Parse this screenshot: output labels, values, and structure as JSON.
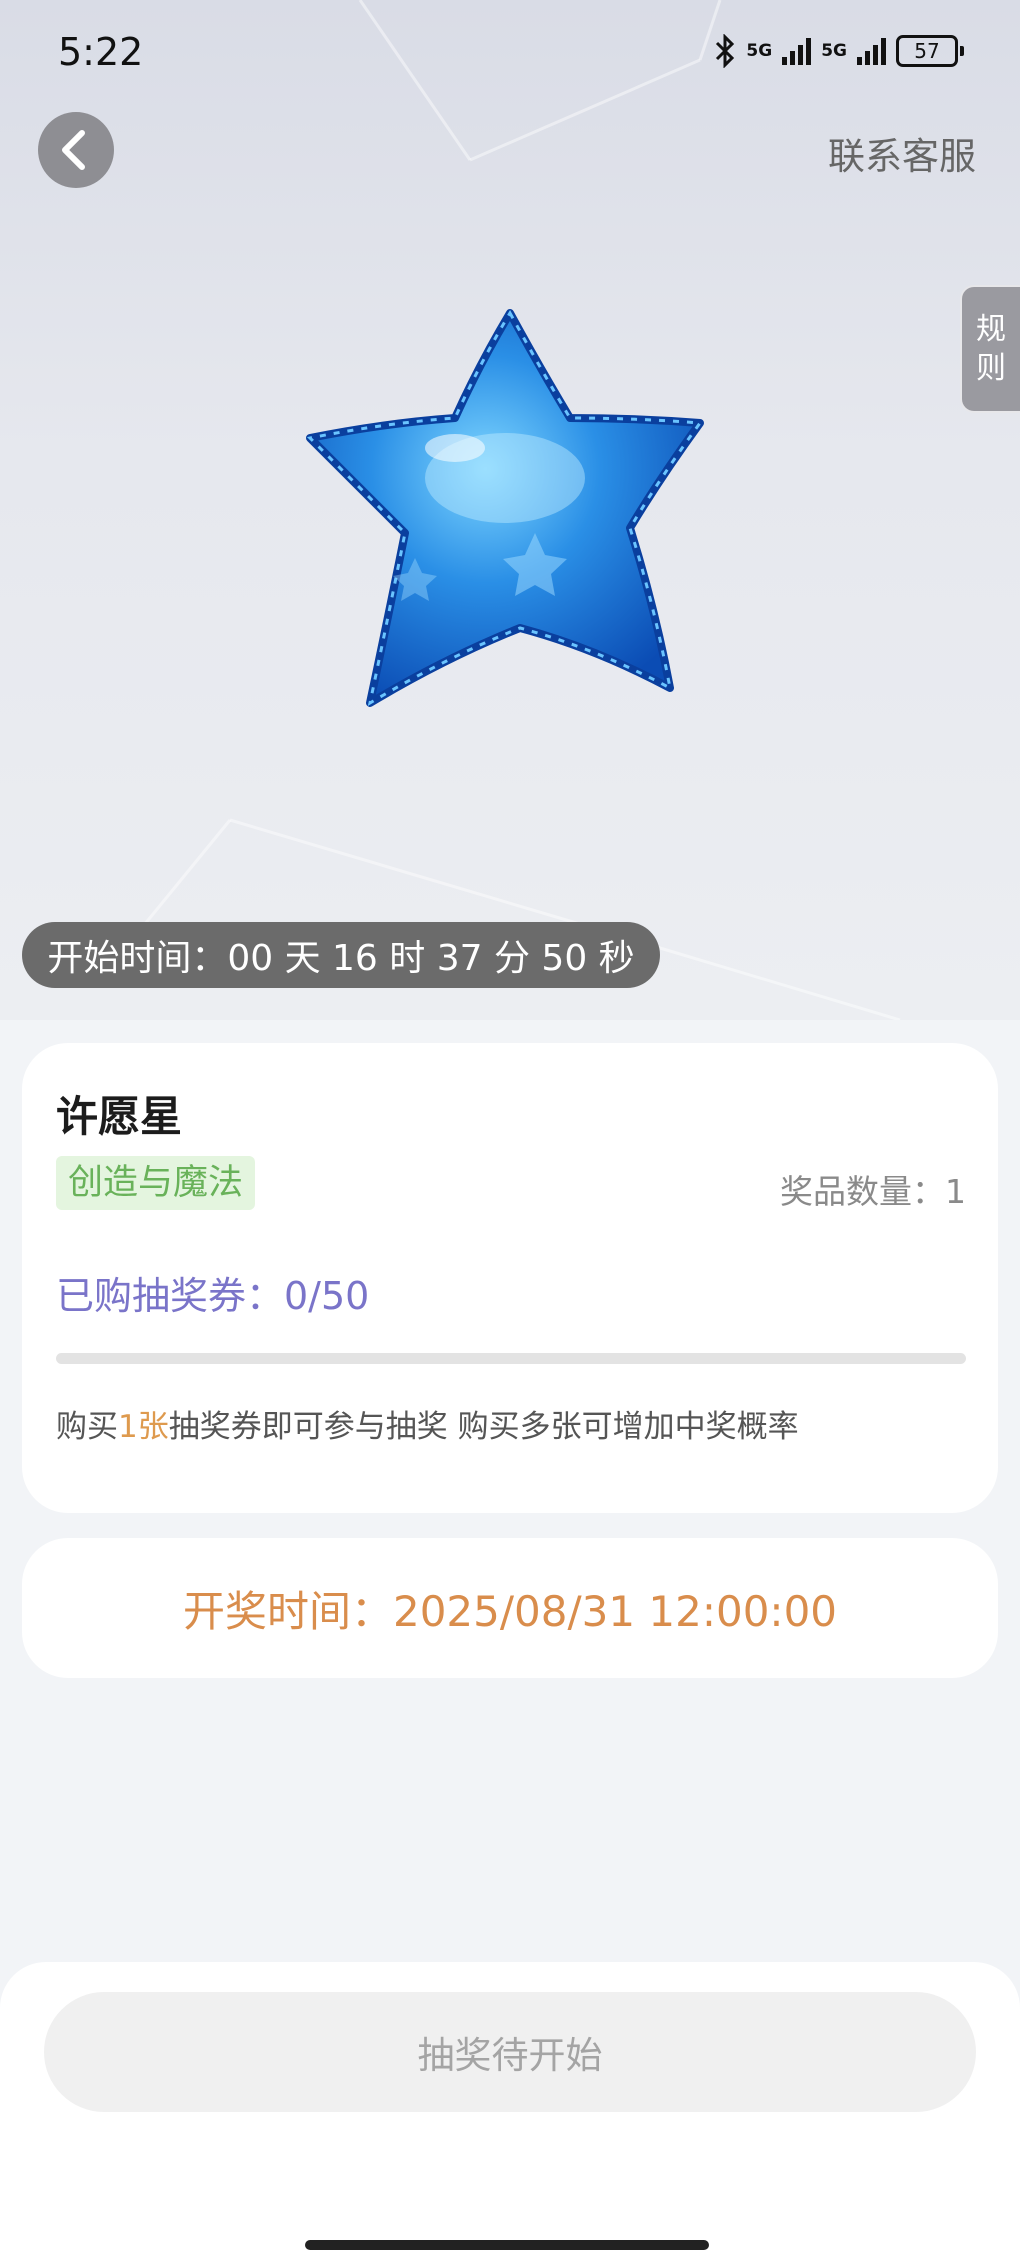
{
  "status_bar": {
    "time": "5:22",
    "network_1": "5G",
    "network_2": "5G",
    "battery": "57",
    "icons": [
      "bluetooth-icon",
      "signal-icon",
      "signal-icon",
      "battery-icon"
    ]
  },
  "header": {
    "back_icon": "chevron-left-icon",
    "customer_service": "联系客服",
    "rules_char_1": "规",
    "rules_char_2": "则"
  },
  "hero": {
    "image": "blue-star-balloon",
    "countdown": "开始时间：00 天 16 时 37 分 50 秒"
  },
  "prize": {
    "name": "许愿星",
    "tag": "创造与魔法",
    "quantity": "奖品数量：1",
    "tickets": "已购抽奖券：0/50",
    "tickets_progress": 0,
    "hint_prefix": "购买",
    "hint_highlight": "1张",
    "hint_suffix": "抽奖券即可参与抽奖 购买多张可增加中奖概率"
  },
  "draw": {
    "time": "开奖时间：2025/08/31 12:00:00",
    "button_label": "抽奖待开始"
  },
  "colors": {
    "accent_purple": "#7a74c9",
    "accent_orange": "#d98d4c",
    "tag_green": "#69b25a",
    "star_blue": "#1f78d6"
  }
}
